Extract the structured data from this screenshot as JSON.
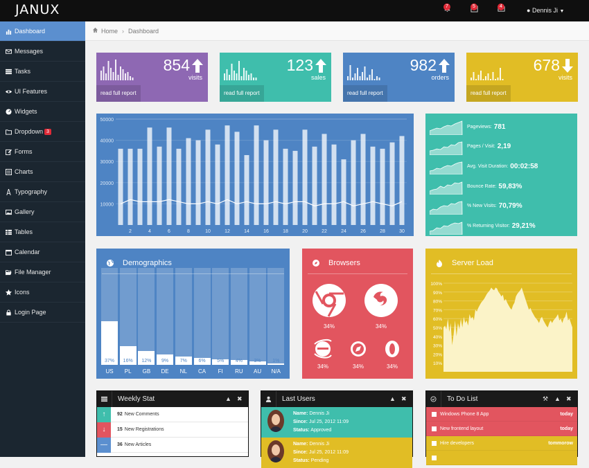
{
  "brand": "JANUX",
  "topbar": {
    "notifications": [
      {
        "icon": "bell-icon",
        "count": "7"
      },
      {
        "icon": "calendar-icon",
        "count": "5"
      },
      {
        "icon": "envelope-icon",
        "count": "4"
      }
    ],
    "user_name": "Dennis Ji"
  },
  "sidebar": {
    "items": [
      {
        "label": "Dashboard",
        "icon": "bar-chart-icon",
        "active": true
      },
      {
        "label": "Messages",
        "icon": "envelope-icon"
      },
      {
        "label": "Tasks",
        "icon": "tasks-icon"
      },
      {
        "label": "UI Features",
        "icon": "eye-icon"
      },
      {
        "label": "Widgets",
        "icon": "dashboard-icon"
      },
      {
        "label": "Dropdown",
        "icon": "folder-icon",
        "badge": "3"
      },
      {
        "label": "Forms",
        "icon": "edit-icon"
      },
      {
        "label": "Charts",
        "icon": "list-alt-icon"
      },
      {
        "label": "Typography",
        "icon": "font-icon"
      },
      {
        "label": "Gallery",
        "icon": "picture-icon"
      },
      {
        "label": "Tables",
        "icon": "table-icon"
      },
      {
        "label": "Calendar",
        "icon": "calendar-icon"
      },
      {
        "label": "File Manager",
        "icon": "folder-open-icon"
      },
      {
        "label": "Icons",
        "icon": "star-icon"
      },
      {
        "label": "Login Page",
        "icon": "lock-icon"
      }
    ]
  },
  "breadcrumb": {
    "home": "Home",
    "current": "Dashboard"
  },
  "stats": [
    {
      "value": "854",
      "label": "visits",
      "direction": "up",
      "color": "#8e68b3",
      "link": "read full report"
    },
    {
      "value": "123",
      "label": "sales",
      "direction": "up",
      "color": "#3fbeac",
      "link": "read full report"
    },
    {
      "value": "982",
      "label": "orders",
      "direction": "up",
      "color": "#4e84c4",
      "link": "read full report"
    },
    {
      "value": "678",
      "label": "visits",
      "direction": "down",
      "color": "#e1bd25",
      "link": "read full report"
    }
  ],
  "chart_data": {
    "type": "bar",
    "x": [
      1,
      2,
      3,
      4,
      5,
      6,
      7,
      8,
      9,
      10,
      11,
      12,
      13,
      14,
      15,
      16,
      17,
      18,
      19,
      20,
      21,
      22,
      23,
      24,
      25,
      26,
      27,
      28,
      29,
      30
    ],
    "xticks": [
      "2",
      "4",
      "6",
      "8",
      "10",
      "12",
      "14",
      "16",
      "18",
      "20",
      "22",
      "24",
      "26",
      "28",
      "30"
    ],
    "yticks": [
      "10000",
      "20000",
      "30000",
      "40000",
      "50000"
    ],
    "ylim": [
      0,
      50000
    ],
    "series": [
      {
        "type": "bar",
        "values": [
          36000,
          36000,
          36000,
          46000,
          37000,
          46000,
          36000,
          41000,
          40000,
          45000,
          38000,
          47000,
          44000,
          33000,
          47000,
          40000,
          45000,
          36000,
          35000,
          45000,
          37000,
          43000,
          38000,
          31000,
          40000,
          43000,
          37000,
          36000,
          39000,
          42000
        ]
      },
      {
        "type": "line",
        "values": [
          10000,
          12000,
          11000,
          11000,
          11000,
          12000,
          11000,
          10000,
          10000,
          11000,
          10000,
          12000,
          10000,
          11000,
          10000,
          10000,
          11000,
          10000,
          11000,
          11000,
          9000,
          10000,
          10000,
          11000,
          9000,
          10000,
          11000,
          10000,
          9000,
          11000
        ]
      }
    ]
  },
  "metrics": [
    {
      "label": "Pageviews:",
      "value": "781"
    },
    {
      "label": "Pages / Visit:",
      "value": "2,19"
    },
    {
      "label": "Avg. Visit Duration:",
      "value": "00:02:58"
    },
    {
      "label": "Bounce Rate:",
      "value": "59,83%"
    },
    {
      "label": "% New Visits:",
      "value": "70,79%"
    },
    {
      "label": "% Returning Visitor:",
      "value": "29,21%"
    }
  ],
  "demographics": {
    "title": "Demographics",
    "countries": [
      {
        "code": "US",
        "pct": "37%",
        "value": 37
      },
      {
        "code": "PL",
        "pct": "16%",
        "value": 16
      },
      {
        "code": "GB",
        "pct": "12%",
        "value": 12
      },
      {
        "code": "DE",
        "pct": "9%",
        "value": 9
      },
      {
        "code": "NL",
        "pct": "7%",
        "value": 7
      },
      {
        "code": "CA",
        "pct": "6%",
        "value": 6
      },
      {
        "code": "FI",
        "pct": "5%",
        "value": 5
      },
      {
        "code": "RU",
        "pct": "4%",
        "value": 4
      },
      {
        "code": "AU",
        "pct": "3%",
        "value": 3
      },
      {
        "code": "N/A",
        "pct": "1%",
        "value": 1
      }
    ]
  },
  "browsers": {
    "title": "Browsers",
    "items": [
      {
        "name": "chrome-icon",
        "pct": "34%"
      },
      {
        "name": "firefox-icon",
        "pct": "34%"
      },
      {
        "name": "ie-icon",
        "pct": "34%"
      },
      {
        "name": "safari-icon",
        "pct": "34%"
      },
      {
        "name": "opera-icon",
        "pct": "34%"
      }
    ]
  },
  "server_load": {
    "title": "Server Load",
    "yticks": [
      "100%",
      "90%",
      "80%",
      "70%",
      "60%",
      "50%",
      "40%",
      "30%",
      "20%",
      "10%"
    ],
    "values": [
      50,
      52,
      48,
      60,
      45,
      55,
      30,
      42,
      58,
      40,
      55,
      48,
      60,
      50,
      62,
      55,
      58,
      52,
      65,
      60,
      62,
      58,
      70,
      68,
      72,
      75,
      78,
      80,
      82,
      85,
      88,
      90,
      92,
      95,
      93,
      92,
      95,
      94,
      90,
      88,
      85,
      87,
      80,
      82,
      78,
      75,
      72,
      70,
      75,
      78,
      85,
      88,
      90,
      92,
      95,
      90,
      85,
      80,
      75,
      70,
      72,
      68,
      65,
      62,
      60,
      58,
      55,
      60,
      62,
      58,
      55,
      52,
      50,
      55,
      58,
      55,
      58,
      60,
      62,
      65,
      58,
      60,
      55,
      60,
      62,
      68,
      58,
      60,
      55,
      50
    ]
  },
  "weekly_stat": {
    "title": "Weekly Stat",
    "rows": [
      {
        "count": "92",
        "text": "New Comments",
        "color": "#3fbeac",
        "sym": "↑"
      },
      {
        "count": "15",
        "text": "New Registrations",
        "color": "#e2555f",
        "sym": "↓"
      },
      {
        "count": "36",
        "text": "New Articles",
        "color": "#5b8fcf",
        "sym": "—"
      }
    ]
  },
  "last_users": {
    "title": "Last Users",
    "users": [
      {
        "name_label": "Name:",
        "name": "Dennis Ji",
        "since_label": "Since:",
        "since": "Jul 25, 2012 11:09",
        "status_label": "Status:",
        "status": "Approved",
        "color": "#3fbeac"
      },
      {
        "name_label": "Name:",
        "name": "Dennis Ji",
        "since_label": "Since:",
        "since": "Jul 25, 2012 11:09",
        "status_label": "Status:",
        "status": "Pending",
        "color": "#e1bd25"
      }
    ]
  },
  "todo": {
    "title": "To Do List",
    "items": [
      {
        "text": "Windows Phone 8 App",
        "due": "today",
        "color": "#e2555f"
      },
      {
        "text": "New frontend layout",
        "due": "today",
        "color": "#e2555f"
      },
      {
        "text": "Hire developers",
        "due": "tommorow",
        "color": "#e1bd25"
      },
      {
        "text": "",
        "due": "",
        "color": "#e1bd25"
      }
    ]
  }
}
